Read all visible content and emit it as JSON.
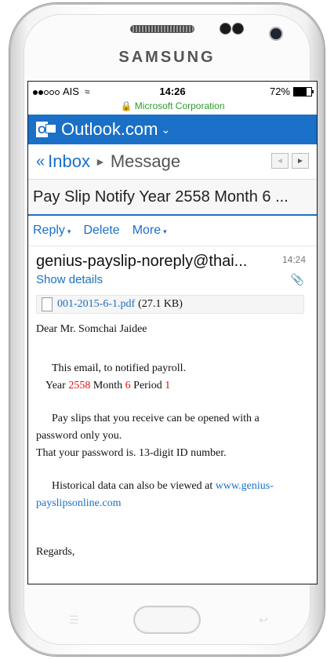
{
  "device": {
    "brand": "SAMSUNG"
  },
  "status": {
    "carrier": "AIS",
    "time": "14:26",
    "battery": "72%",
    "battery_fraction": 0.72
  },
  "url": {
    "site": "Microsoft Corporation"
  },
  "outlook": {
    "title": "Outlook.com",
    "logo_letter": "O"
  },
  "nav": {
    "back": "«",
    "inbox": "Inbox",
    "separator": "►",
    "current": "Message",
    "prev": "◄",
    "next": "►"
  },
  "subject": "Pay Slip Notify Year 2558 Month 6 ...",
  "actions": {
    "reply": "Reply",
    "delete": "Delete",
    "more": "More",
    "caret": "▾"
  },
  "sender": {
    "address": "genius-payslip-noreply@thai...",
    "time": "14:24",
    "show_details": "Show details"
  },
  "attachment": {
    "name": "001-2015-6-1.pdf",
    "size": "(27.1 KB)"
  },
  "body": {
    "greeting": "Dear Mr. Somchai Jaidee",
    "line1": "This email, to notified payroll.",
    "year_label": "Year ",
    "year": "2558",
    "month_label": " Month ",
    "month": "6",
    "period_label": " Period ",
    "period": "1",
    "pay1": "Pay slips that you receive can be opened with a",
    "pay2": "password only you.",
    "pay3": "That your password is. 13-digit ID number.",
    "hist1": "Historical data can also be viewed at ",
    "hist_link1": "www.genius-",
    "hist_link2": "payslipsonline.com",
    "regards": "Regards,"
  }
}
